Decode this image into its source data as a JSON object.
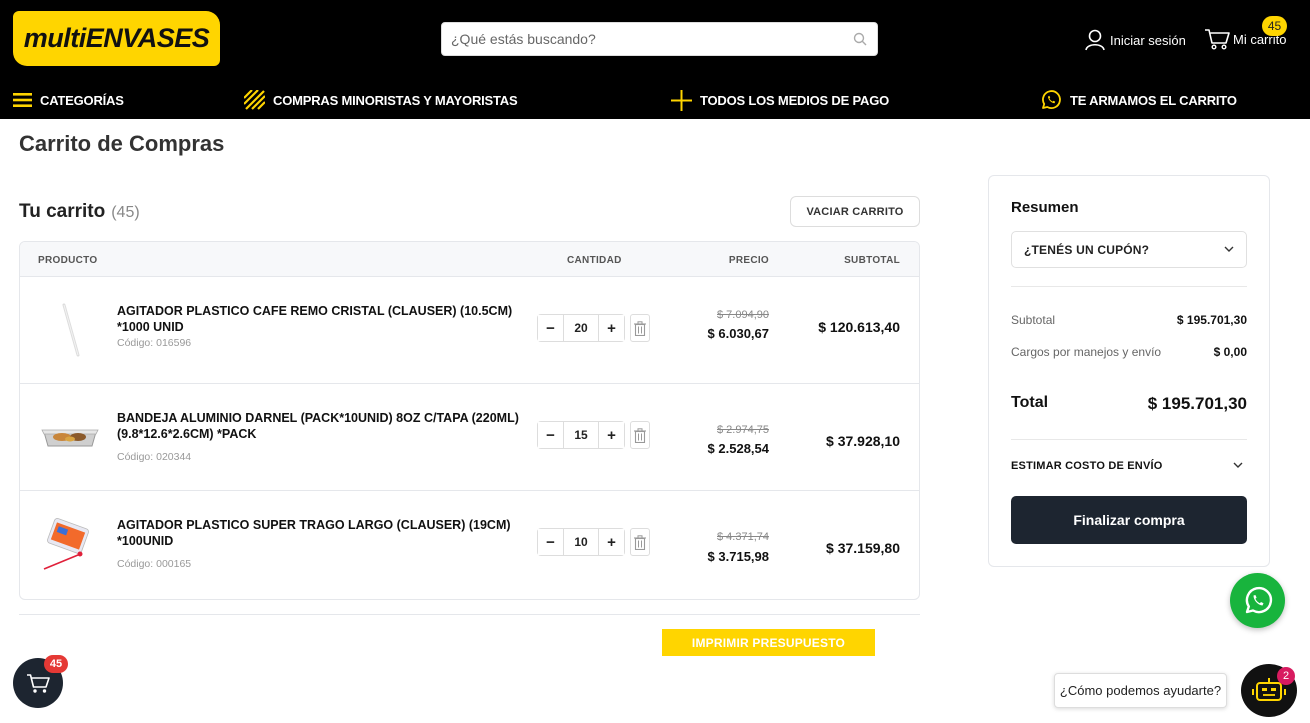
{
  "header": {
    "logo_text": "multiENVASES",
    "search_placeholder": "¿Qué estás buscando?",
    "login_label": "Iniciar sesión",
    "cart_label": "Mi carrito",
    "cart_badge": "45"
  },
  "nav": {
    "items": [
      {
        "label": "CATEGORÍAS",
        "icon": "hamburger-icon"
      },
      {
        "label": "COMPRAS MINORISTAS Y MAYORISTAS",
        "icon": "stripes-icon"
      },
      {
        "label": "TODOS LOS MEDIOS DE PAGO",
        "icon": "plus-icon"
      },
      {
        "label": "TE ARMAMOS EL CARRITO",
        "icon": "whatsapp-icon"
      }
    ]
  },
  "page_title": "Carrito de Compras",
  "cart": {
    "title": "Tu carrito",
    "count": "(45)",
    "clear_label": "VACIAR CARRITO",
    "columns": {
      "product": "PRODUCTO",
      "quantity": "CANTIDAD",
      "price": "PRECIO",
      "subtotal": "SUBTOTAL"
    },
    "items": [
      {
        "name": "AGITADOR PLASTICO CAFE REMO CRISTAL (CLAUSER) (10.5CM) *1000 UNID",
        "code": "Código: 016596",
        "qty": "20",
        "old_price": "$ 7.094,90",
        "price": "$ 6.030,67",
        "subtotal": "$ 120.613,40",
        "minus": "−",
        "plus": "+"
      },
      {
        "name": "BANDEJA ALUMINIO DARNEL (PACK*10UNID) 8OZ C/TAPA (220ML) (9.8*12.6*2.6CM) *PACK",
        "code": "Código: 020344",
        "qty": "15",
        "old_price": "$ 2.974,75",
        "price": "$ 2.528,54",
        "subtotal": "$ 37.928,10",
        "minus": "−",
        "plus": "+"
      },
      {
        "name": "AGITADOR PLASTICO SUPER TRAGO LARGO (CLAUSER) (19CM) *100UNID",
        "code": "Código: 000165",
        "qty": "10",
        "old_price": "$ 4.371,74",
        "price": "$ 3.715,98",
        "subtotal": "$ 37.159,80",
        "minus": "−",
        "plus": "+"
      }
    ],
    "print_label": "IMPRIMIR PRESUPUESTO"
  },
  "summary": {
    "title": "Resumen",
    "coupon_label": "¿TENÉS UN CUPÓN?",
    "subtotal_label": "Subtotal",
    "subtotal_value": "$ 195.701,30",
    "shipping_label": "Cargos por manejos y envío",
    "shipping_value": "$ 0,00",
    "total_label": "Total",
    "total_value": "$ 195.701,30",
    "estimate_label": "ESTIMAR COSTO DE ENVÍO",
    "checkout_label": "Finalizar compra"
  },
  "floating": {
    "cart_badge": "45",
    "help_text": "¿Cómo podemos ayudarte?",
    "bot_badge": "2"
  },
  "colors": {
    "brand_yellow": "#ffd500",
    "dark": "#1d2530",
    "whatsapp": "#18b43d"
  }
}
